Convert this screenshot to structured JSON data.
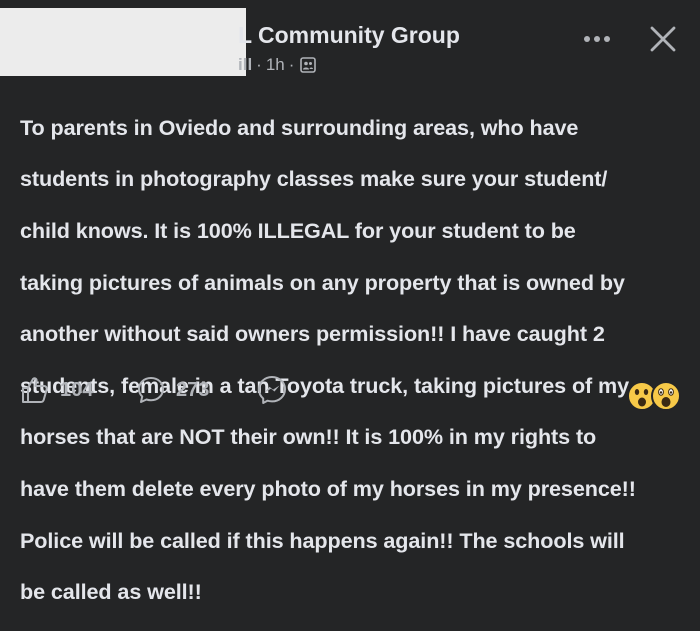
{
  "header": {
    "group_name_visible": "L Community Group",
    "author_visible": "ill",
    "separator": "·",
    "time": "1h",
    "icons": {
      "more": "more-dots-icon",
      "close": "close-icon",
      "audience": "group-members-icon"
    }
  },
  "post": {
    "lines": [
      "To parents in Oviedo and surrounding areas, who have",
      "students in photography classes make sure your student/",
      "child knows. It is 100% ILLEGAL for your student to be",
      "taking pictures of animals on any property that is owned by",
      "another without said owners permission!! I have caught 2",
      "students, female in a tan Toyota truck, taking pictures of my",
      "horses that are NOT their own!! It is 100% in my rights to",
      "have them delete every photo of my horses in my presence!!",
      "Police will be called if this happens again!! The schools  will",
      "be called as well!!"
    ]
  },
  "footer": {
    "like_count": "104",
    "comment_count": "273",
    "icons": {
      "like": "thumbs-up-icon",
      "comment": "comment-bubble-icon",
      "share": "messenger-icon",
      "reactions": "surprised-emoji-icon"
    }
  },
  "colors": {
    "background": "#242526",
    "primary_text": "#e4e6eb",
    "secondary_text": "#b0b3b8",
    "redaction": "#ececec"
  }
}
